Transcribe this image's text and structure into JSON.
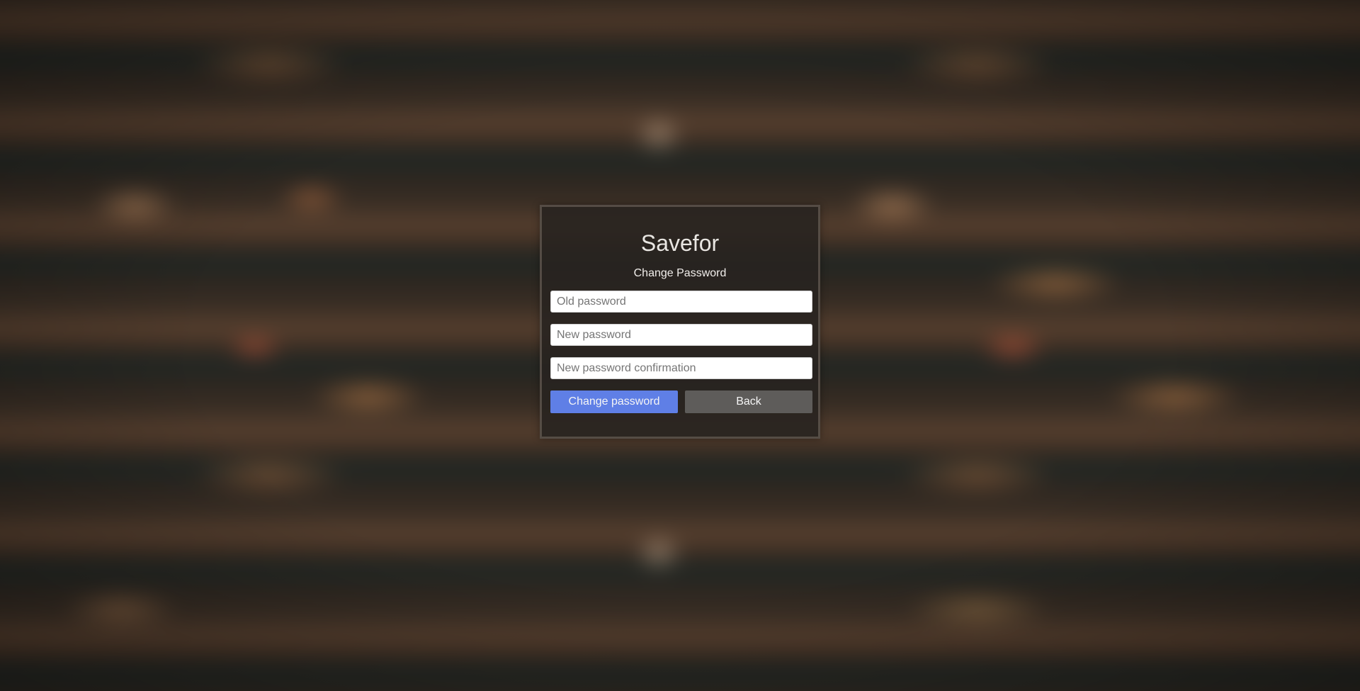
{
  "app": {
    "title": "Savefor"
  },
  "form": {
    "heading": "Change Password",
    "old_password_placeholder": "Old password",
    "new_password_placeholder": "New password",
    "confirm_password_placeholder": "New password confirmation"
  },
  "actions": {
    "submit_label": "Change password",
    "back_label": "Back"
  },
  "colors": {
    "primary_button": "#5f7fe6",
    "secondary_button": "#5e5c5a",
    "card_background": "#28231f"
  }
}
